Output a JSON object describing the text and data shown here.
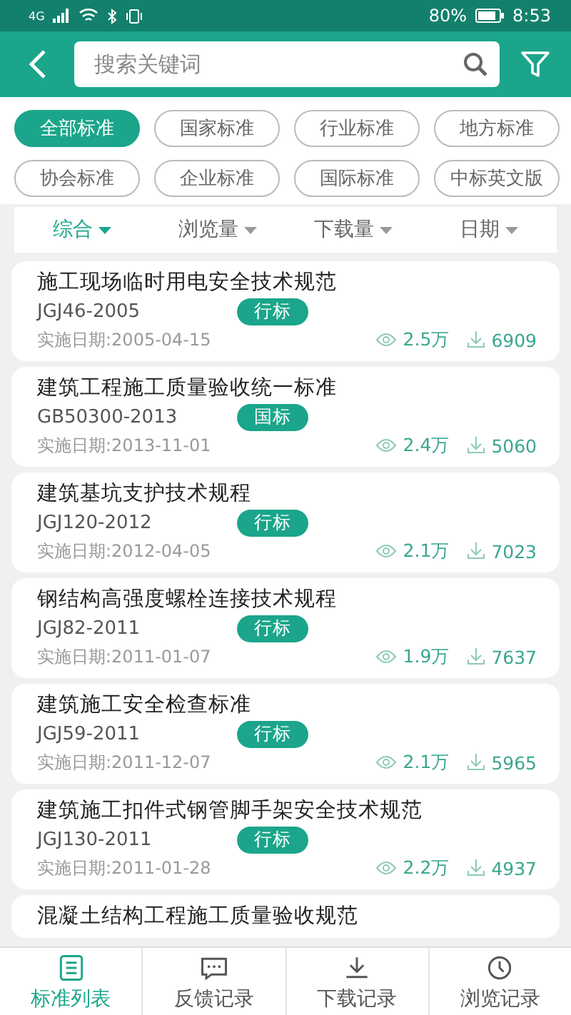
{
  "status_bar": {
    "network": "4G",
    "battery": "80%",
    "time": "8:53"
  },
  "search": {
    "placeholder": "搜索关键词"
  },
  "categories": [
    {
      "label": "全部标准",
      "selected": true
    },
    {
      "label": "国家标准",
      "selected": false
    },
    {
      "label": "行业标准",
      "selected": false
    },
    {
      "label": "地方标准",
      "selected": false
    },
    {
      "label": "协会标准",
      "selected": false
    },
    {
      "label": "企业标准",
      "selected": false
    },
    {
      "label": "国际标准",
      "selected": false
    },
    {
      "label": "中标英文版",
      "selected": false
    }
  ],
  "sort_options": [
    {
      "label": "综合",
      "selected": true
    },
    {
      "label": "浏览量",
      "selected": false
    },
    {
      "label": "下载量",
      "selected": false
    },
    {
      "label": "日期",
      "selected": false
    }
  ],
  "standards": [
    {
      "title": "施工现场临时用电安全技术规范",
      "code": "JGJ46-2005",
      "tag": "行标",
      "date": "实施日期:2005-04-15",
      "views": "2.5万",
      "downloads": "6909"
    },
    {
      "title": "建筑工程施工质量验收统一标准",
      "code": "GB50300-2013",
      "tag": "国标",
      "date": "实施日期:2013-11-01",
      "views": "2.4万",
      "downloads": "5060"
    },
    {
      "title": "建筑基坑支护技术规程",
      "code": "JGJ120-2012",
      "tag": "行标",
      "date": "实施日期:2012-04-05",
      "views": "2.1万",
      "downloads": "7023"
    },
    {
      "title": "钢结构高强度螺栓连接技术规程",
      "code": "JGJ82-2011",
      "tag": "行标",
      "date": "实施日期:2011-01-07",
      "views": "1.9万",
      "downloads": "7637"
    },
    {
      "title": "建筑施工安全检查标准",
      "code": "JGJ59-2011",
      "tag": "行标",
      "date": "实施日期:2011-12-07",
      "views": "2.1万",
      "downloads": "5965"
    },
    {
      "title": "建筑施工扣件式钢管脚手架安全技术规范",
      "code": "JGJ130-2011",
      "tag": "行标",
      "date": "实施日期:2011-01-28",
      "views": "2.2万",
      "downloads": "4937"
    },
    {
      "title": "混凝土结构工程施工质量验收规范"
    }
  ],
  "bottom_tabs": [
    {
      "label": "标准列表",
      "kind": "list",
      "selected": true
    },
    {
      "label": "反馈记录",
      "kind": "chat",
      "selected": false
    },
    {
      "label": "下载记录",
      "kind": "download",
      "selected": false
    },
    {
      "label": "浏览记录",
      "kind": "history",
      "selected": false
    }
  ]
}
